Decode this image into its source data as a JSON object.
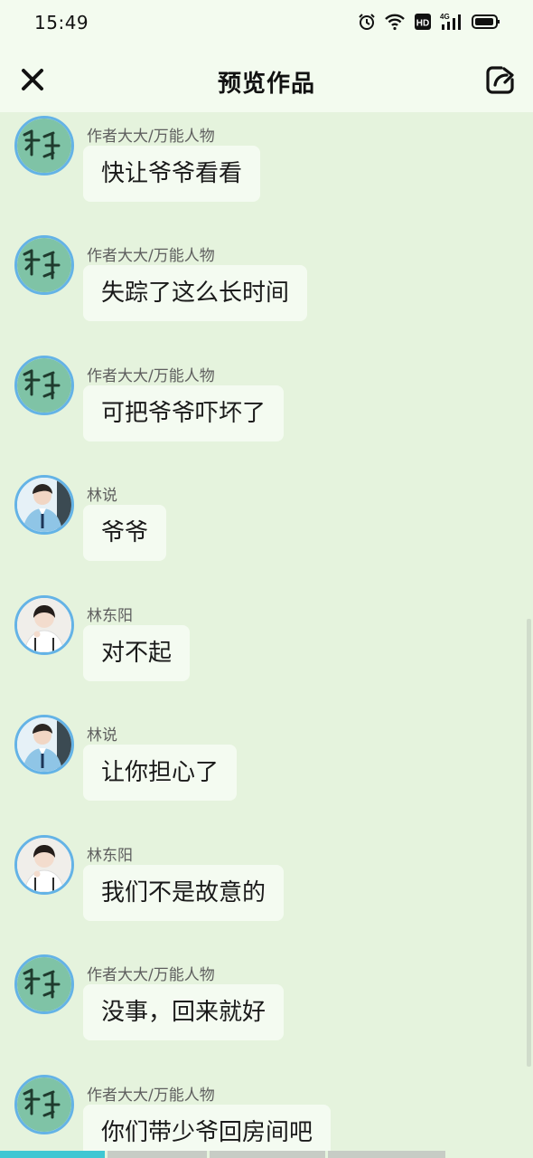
{
  "status_bar": {
    "time": "15:49",
    "icons": [
      "alarm-icon",
      "wifi-icon",
      "hd-icon",
      "signal-4g-icon",
      "battery-icon"
    ],
    "network_label": "4G",
    "hd_label": "HD"
  },
  "header": {
    "title": "预览作品",
    "close_icon": "close-icon",
    "share_icon": "share-icon"
  },
  "colors": {
    "background": "#e5f3dd",
    "bubble": "#f4fbf1",
    "avatar_ring": "#64b3e6",
    "progress_active": "#3fc7d3"
  },
  "messages": [
    {
      "sender": "作者大大/万能人物",
      "avatar": "xin-avatar",
      "text": "快让爷爷看看"
    },
    {
      "sender": "作者大大/万能人物",
      "avatar": "xin-avatar",
      "text": "失踪了这么长时间"
    },
    {
      "sender": "作者大大/万能人物",
      "avatar": "xin-avatar",
      "text": "可把爷爷吓坏了"
    },
    {
      "sender": "林说",
      "avatar": "linshuo-avatar",
      "text": "爷爷"
    },
    {
      "sender": "林东阳",
      "avatar": "lindongyang-avatar",
      "text": "对不起"
    },
    {
      "sender": "林说",
      "avatar": "linshuo-avatar",
      "text": "让你担心了"
    },
    {
      "sender": "林东阳",
      "avatar": "lindongyang-avatar",
      "text": "我们不是故意的"
    },
    {
      "sender": "作者大大/万能人物",
      "avatar": "xin-avatar",
      "text": "没事，回来就好"
    },
    {
      "sender": "作者大大/万能人物",
      "avatar": "xin-avatar",
      "text": "你们带少爷回房间吧"
    }
  ],
  "progress": {
    "segments": 4,
    "current_fraction": 0.18
  }
}
